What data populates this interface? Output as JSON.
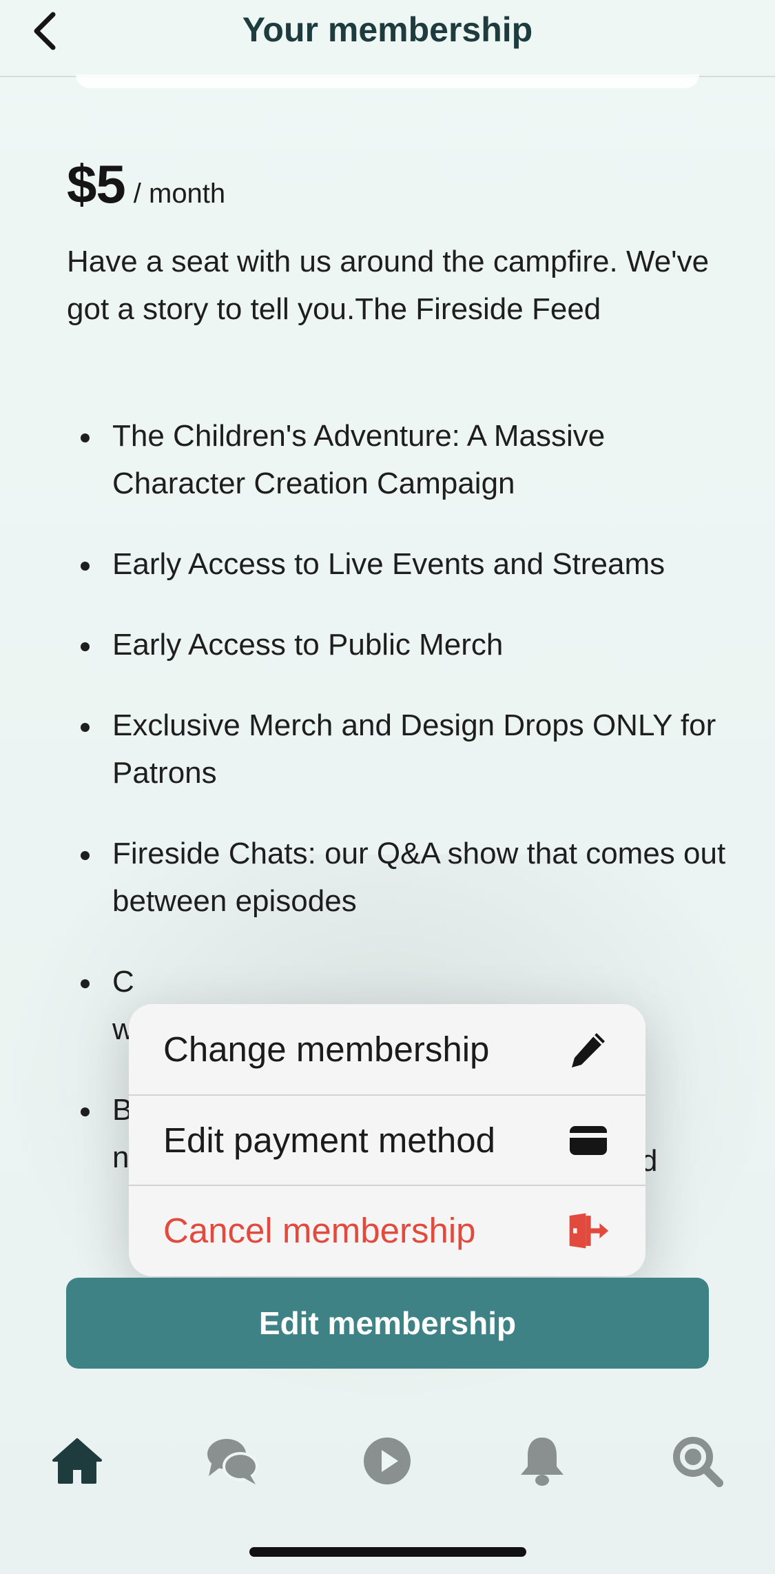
{
  "header": {
    "title": "Your membership"
  },
  "tier": {
    "price": "$5",
    "period": "/ month",
    "description": "Have a seat with us around the campfire. We've got a story to tell you.The Fireside Feed",
    "benefits": [
      "The Children's Adventure: A Massive Character Creation Campaign",
      "Early Access to Live Events and Streams",
      "Early Access to Public Merch",
      "Exclusive Merch and Design Drops ONLY for Patrons",
      "Fireside Chats: our Q&A show that comes out between episodes",
      "C",
      "B"
    ],
    "benefit_partials": [
      "w",
      "n",
      "d"
    ]
  },
  "menu": {
    "items": [
      {
        "label": "Change membership",
        "icon": "pencil-icon"
      },
      {
        "label": "Edit payment method",
        "icon": "credit-card-icon"
      },
      {
        "label": "Cancel membership",
        "icon": "exit-door-icon"
      }
    ]
  },
  "edit_button": {
    "label": "Edit membership"
  },
  "nav": {
    "items": [
      {
        "icon": "home-icon",
        "active": true
      },
      {
        "icon": "chat-icon",
        "active": false
      },
      {
        "icon": "play-icon",
        "active": false
      },
      {
        "icon": "bell-icon",
        "active": false
      },
      {
        "icon": "search-icon",
        "active": false
      }
    ]
  },
  "colors": {
    "accent": "#3e8286",
    "danger": "#e14a3c",
    "nav_active": "#1e3b3d",
    "nav_inactive": "#8a8f8f"
  }
}
